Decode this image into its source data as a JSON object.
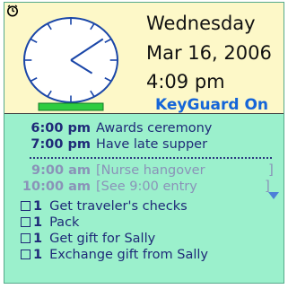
{
  "header": {
    "day": "Wednesday",
    "date": "Mar 16, 2006",
    "time": "4:09 pm",
    "keyguard": "KeyGuard On",
    "clock_time": {
      "hour": 4,
      "minute": 9
    }
  },
  "icons": {
    "alarm": "alarm-clock-icon",
    "scroll": "scroll-down-arrow-icon"
  },
  "colors": {
    "background": "#9bf0cc",
    "header": "#fdf8c8",
    "keyguard": "#1565d8",
    "text": "#1f2a78",
    "inactive": "#8a93b8",
    "clock_bar": "#2ecc40"
  },
  "appointments": [
    {
      "time": "6:00 pm",
      "desc": "Awards ceremony"
    },
    {
      "time": "7:00 pm",
      "desc": "Have late supper"
    }
  ],
  "next_appointments": [
    {
      "time": "9:00 am",
      "desc": "[Nurse hangover"
    },
    {
      "time": "10:00 am",
      "desc": "[See 9:00 entry"
    }
  ],
  "tasks": [
    {
      "priority": "1",
      "desc": "Get traveler's checks"
    },
    {
      "priority": "1",
      "desc": "Pack"
    },
    {
      "priority": "1",
      "desc": "Get gift for Sally"
    },
    {
      "priority": "1",
      "desc": "Exchange gift from Sally"
    }
  ]
}
